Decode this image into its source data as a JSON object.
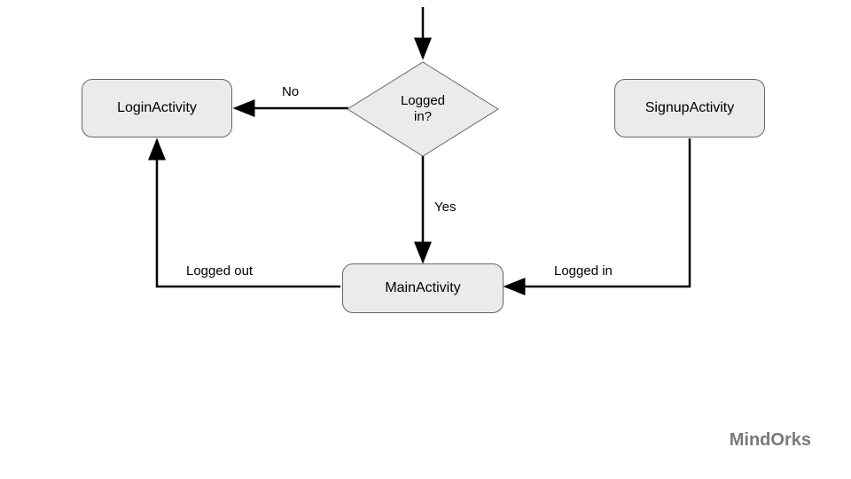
{
  "nodes": {
    "login": "LoginActivity",
    "signup": "SignupActivity",
    "main": "MainActivity",
    "decision": "Logged in?"
  },
  "edges": {
    "no": "No",
    "yes": "Yes",
    "logged_out": "Logged out",
    "logged_in": "Logged in"
  },
  "watermark": "MindOrks",
  "colors": {
    "node_fill": "#ebebeb",
    "node_stroke": "#666666",
    "arrow": "#000000",
    "watermark": "#7a7a7a"
  }
}
